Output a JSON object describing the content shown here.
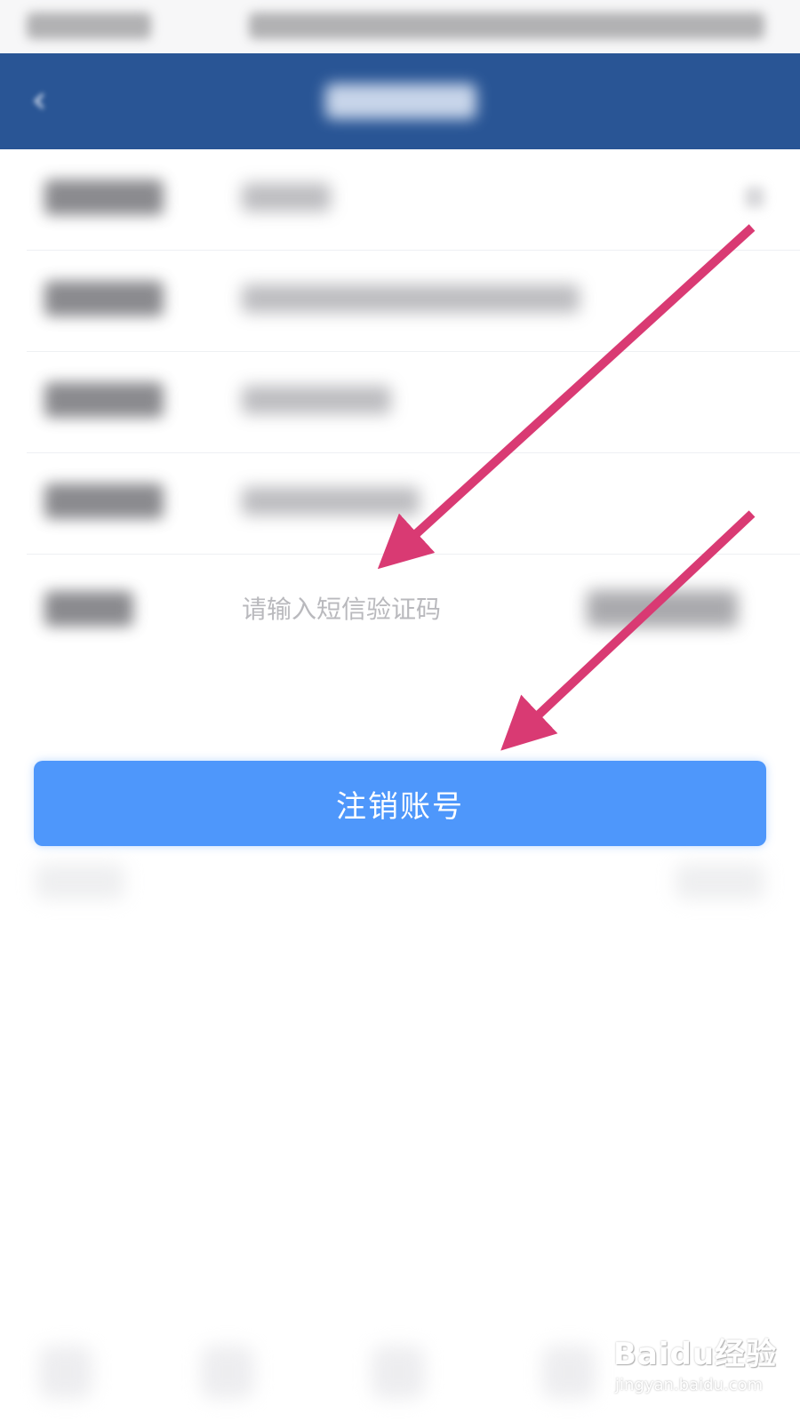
{
  "form": {
    "code_input": {
      "placeholder": "请输入短信验证码",
      "value": ""
    }
  },
  "actions": {
    "cancel_account_label": "注销账号"
  },
  "colors": {
    "header_background": "#295595",
    "primary_button": "#4e97fb",
    "annotation_arrow": "#d93a73",
    "page_background": "#ffffff"
  },
  "icons": {
    "back": "back-arrow-icon"
  },
  "watermark": {
    "brand": "Baidu经验",
    "url": "jingyan.baidu.com"
  }
}
